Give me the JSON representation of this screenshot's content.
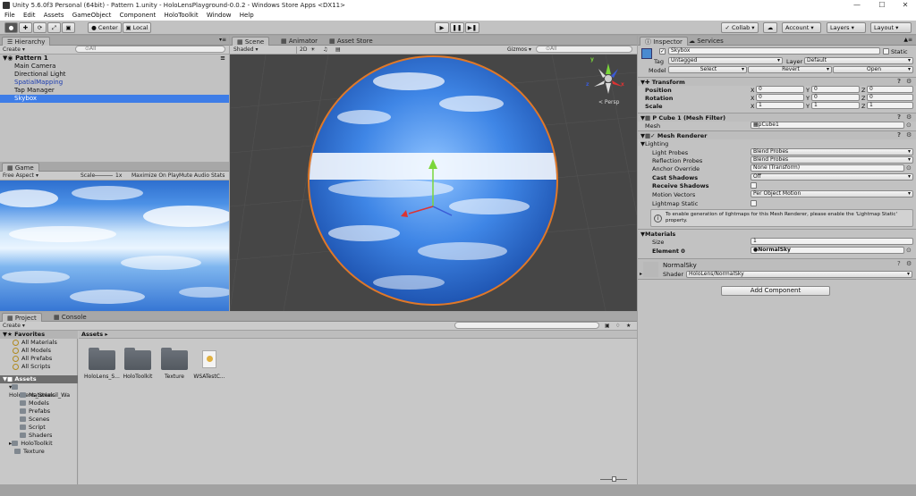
{
  "window": {
    "title": "Unity 5.6.0f3 Personal (64bit) - Pattern 1.unity - HoloLensPlayground-0.0.2 - Windows Store Apps <DX11>",
    "minimize": "—",
    "maximize": "☐",
    "close": "✕"
  },
  "menu": [
    "File",
    "Edit",
    "Assets",
    "GameObject",
    "Component",
    "HoloToolkit",
    "Window",
    "Help"
  ],
  "toolbar": {
    "pivot": "Center",
    "space": "Local",
    "collab": "Collab ▾",
    "account": "Account",
    "layers": "Layers",
    "layout": "Layout"
  },
  "hierarchy": {
    "tab": "Hierarchy",
    "create": "Create",
    "search_placeholder": "⊙All",
    "scene": "Pattern 1",
    "items": [
      {
        "label": "Main Camera",
        "color": "#111111"
      },
      {
        "label": "Directional Light",
        "color": "#111111"
      },
      {
        "label": "SpatialMapping",
        "color": "#1a3bb0"
      },
      {
        "label": "Tap Manager",
        "color": "#111111"
      },
      {
        "label": "Skybox",
        "color": "#ffffff"
      }
    ]
  },
  "game": {
    "tab": "Game",
    "aspect": "Free Aspect",
    "scale_label": "Scale",
    "scale_value": "1x",
    "maximize": "Maximize On Play",
    "mute": "Mute Audio",
    "stats": "Stats"
  },
  "scene_view": {
    "tabs": [
      "Scene",
      "Animator",
      "Asset Store"
    ],
    "shading": "Shaded",
    "mode2d": "2D",
    "gizmos": "Gizmos ▾",
    "search_placeholder": "⊙All",
    "persp": "< Persp",
    "axis": {
      "y": "y",
      "x": "x",
      "z": "z"
    }
  },
  "project": {
    "tabs": [
      "Project",
      "Console"
    ],
    "create": "Create",
    "favorites_title": "Favorites",
    "favorites": [
      "All Materials",
      "All Models",
      "All Prefabs",
      "All Scripts"
    ],
    "assets_title": "Assets",
    "tree": [
      {
        "label": "HoloLens_Stencil_Wa",
        "depth": 1,
        "arrow": "▾"
      },
      {
        "label": "Materials",
        "depth": 2,
        "arrow": ""
      },
      {
        "label": "Models",
        "depth": 2,
        "arrow": ""
      },
      {
        "label": "Prefabs",
        "depth": 2,
        "arrow": ""
      },
      {
        "label": "Scenes",
        "depth": 2,
        "arrow": ""
      },
      {
        "label": "Script",
        "depth": 2,
        "arrow": ""
      },
      {
        "label": "Shaders",
        "depth": 2,
        "arrow": ""
      },
      {
        "label": "HoloToolkit",
        "depth": 1,
        "arrow": "▸"
      },
      {
        "label": "Texture",
        "depth": 1,
        "arrow": ""
      }
    ],
    "breadcrumb": "Assets ▸",
    "grid": [
      {
        "label": "HoloLens_S...",
        "kind": "folder"
      },
      {
        "label": "HoloToolkit",
        "kind": "folder"
      },
      {
        "label": "Texture",
        "kind": "folder"
      },
      {
        "label": "WSATestC...",
        "kind": "file"
      }
    ]
  },
  "inspector": {
    "tabs": [
      "Inspector",
      "Services"
    ],
    "object_name": "Skybox",
    "static_label": "Static",
    "tag_label": "Tag",
    "tag_value": "Untagged",
    "layer_label": "Layer",
    "layer_value": "Default",
    "model_label": "Model",
    "model_select": "Select",
    "model_revert": "Revert",
    "model_open": "Open",
    "transform": {
      "title": "Transform",
      "rows": [
        {
          "label": "Position",
          "x": "0",
          "y": "0",
          "z": "0"
        },
        {
          "label": "Rotation",
          "x": "0",
          "y": "0",
          "z": "0"
        },
        {
          "label": "Scale",
          "x": "1",
          "y": "1",
          "z": "1"
        }
      ]
    },
    "mesh_filter": {
      "title": "P Cube 1 (Mesh Filter)",
      "mesh_label": "Mesh",
      "mesh_value": "pCube1"
    },
    "mesh_renderer": {
      "title": "Mesh Renderer",
      "lighting": "Lighting",
      "light_probes_label": "Light Probes",
      "light_probes_value": "Blend Probes",
      "reflection_probes_label": "Reflection Probes",
      "reflection_probes_value": "Blend Probes",
      "anchor_label": "Anchor Override",
      "anchor_value": "None (Transform)",
      "cast_shadows_label": "Cast Shadows",
      "cast_shadows_value": "Off",
      "receive_shadows_label": "Receive Shadows",
      "motion_vectors_label": "Motion Vectors",
      "motion_vectors_value": "Per Object Motion",
      "lightmap_static_label": "Lightmap Static",
      "info": "To enable generation of lightmaps for this Mesh Renderer, please enable the 'Lightmap Static' property."
    },
    "materials": {
      "title": "Materials",
      "size_label": "Size",
      "size_value": "1",
      "element_label": "Element 0",
      "element_value": "NormalSky"
    },
    "material": {
      "name": "NormalSky",
      "shader_label": "Shader",
      "shader_value": "HoloLens/NormalSky"
    },
    "add_component": "Add Component"
  }
}
